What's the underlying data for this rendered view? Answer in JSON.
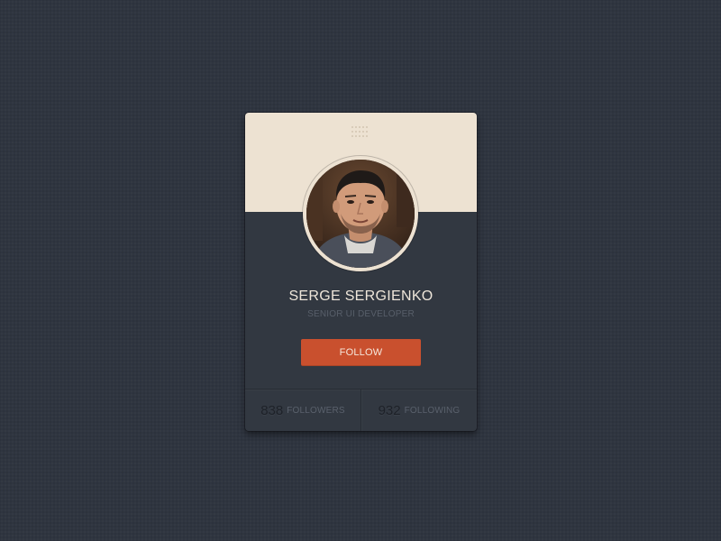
{
  "profile": {
    "name": "SERGE SERGIENKO",
    "role": "SENIOR UI DEVELOPER",
    "avatar_icon": "user-photo"
  },
  "actions": {
    "follow_label": "FOLLOW"
  },
  "stats": {
    "followers_count": "838",
    "followers_label": "FOLLOWERS",
    "following_count": "932",
    "following_label": "FOLLOWING"
  },
  "colors": {
    "background": "#2f3540",
    "card": "#323841",
    "header": "#ede2d2",
    "accent": "#c9502e"
  },
  "icons": {
    "grip": "grip-dots-icon"
  }
}
